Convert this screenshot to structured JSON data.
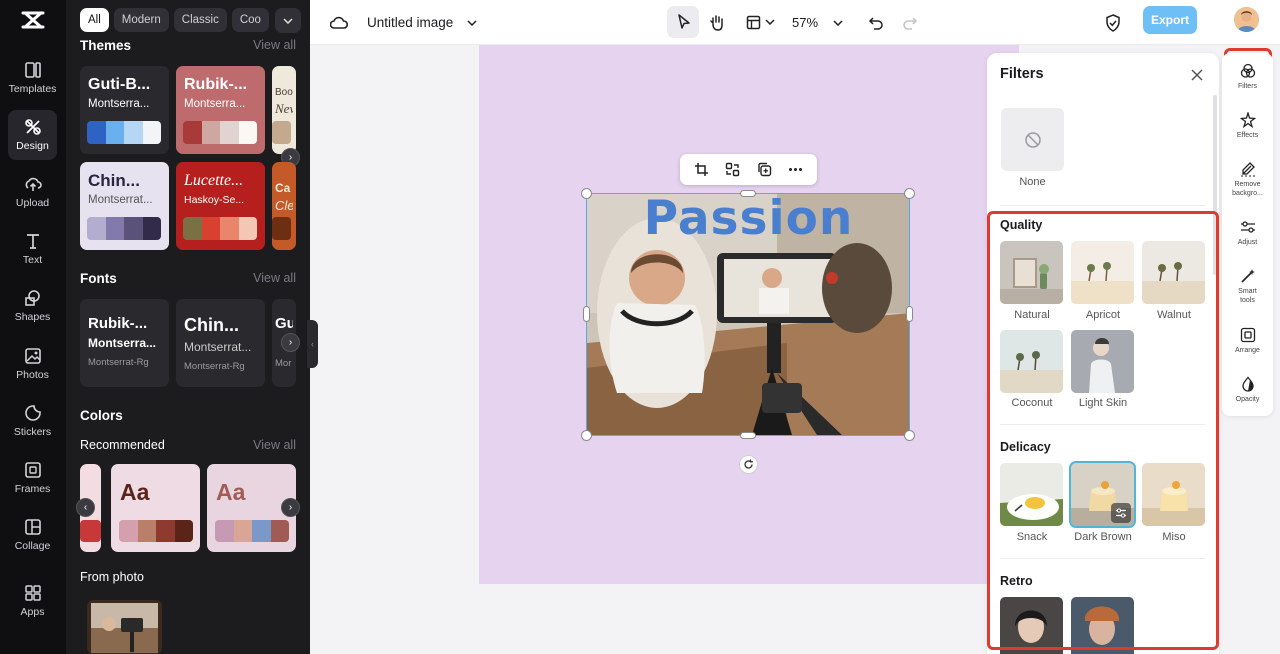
{
  "colors": {
    "accent": "#6dbff5",
    "highlight": "#e03a2c",
    "canvas_bg": "#e5d3ef",
    "selection": "#5aa9e6"
  },
  "rail": {
    "items": [
      {
        "label": "Templates",
        "icon": "templates-icon"
      },
      {
        "label": "Design",
        "icon": "design-icon",
        "active": true
      },
      {
        "label": "Upload",
        "icon": "upload-icon"
      },
      {
        "label": "Text",
        "icon": "text-icon"
      },
      {
        "label": "Shapes",
        "icon": "shapes-icon"
      },
      {
        "label": "Photos",
        "icon": "photos-icon"
      },
      {
        "label": "Stickers",
        "icon": "stickers-icon"
      },
      {
        "label": "Frames",
        "icon": "frames-icon"
      },
      {
        "label": "Collage",
        "icon": "collage-icon"
      },
      {
        "label": "Apps",
        "icon": "apps-icon"
      }
    ]
  },
  "panel": {
    "chips": [
      "All",
      "Modern",
      "Classic",
      "Coo"
    ],
    "themes_title": "Themes",
    "view_all": "View all",
    "themes": [
      {
        "title": "Guti-B...",
        "sub": "Montserra..."
      },
      {
        "title": "Rubik-...",
        "sub": "Montserra..."
      },
      {
        "title": "Boo",
        "sub": "Nev"
      },
      {
        "title": "Chin...",
        "sub": "Montserrat..."
      },
      {
        "title": "Lucette...",
        "sub": "Haskoy-Se..."
      },
      {
        "title": "Ca",
        "sub": "Cle"
      }
    ],
    "fonts_title": "Fonts",
    "fonts": [
      {
        "title": "Rubik-...",
        "sub": "Montserra...",
        "small": "Montserrat-Rg"
      },
      {
        "title": "Chin...",
        "sub": "Montserrat...",
        "small": "Montserrat-Rg"
      },
      {
        "title": "Gu",
        "sub": "",
        "small": "Mor"
      }
    ],
    "colors_title": "Colors",
    "recommended": "Recommended",
    "aa": "Aa",
    "from_photo": "From photo"
  },
  "topbar": {
    "title": "Untitled image",
    "zoom": "57%",
    "export": "Export"
  },
  "canvas": {
    "headline": "Passion"
  },
  "filters": {
    "title": "Filters",
    "none_label": "None",
    "sections": [
      {
        "name": "Quality",
        "items": [
          "Natural",
          "Apricot",
          "Walnut",
          "Coconut",
          "Light Skin"
        ]
      },
      {
        "name": "Delicacy",
        "items": [
          "Snack",
          "Dark Brown",
          "Miso"
        ],
        "selected": "Dark Brown"
      },
      {
        "name": "Retro",
        "items": [
          "",
          ""
        ]
      }
    ]
  },
  "tools": [
    {
      "label": "Filters",
      "icon": "filters-icon",
      "active": true
    },
    {
      "label": "Effects",
      "icon": "effects-icon"
    },
    {
      "label": "Remove backgro...",
      "icon": "remove-background-icon"
    },
    {
      "label": "Adjust",
      "icon": "adjust-icon"
    },
    {
      "label": "Smart tools",
      "icon": "smart-tools-icon"
    },
    {
      "label": "Arrange",
      "icon": "arrange-icon"
    },
    {
      "label": "Opacity",
      "icon": "opacity-icon"
    }
  ]
}
